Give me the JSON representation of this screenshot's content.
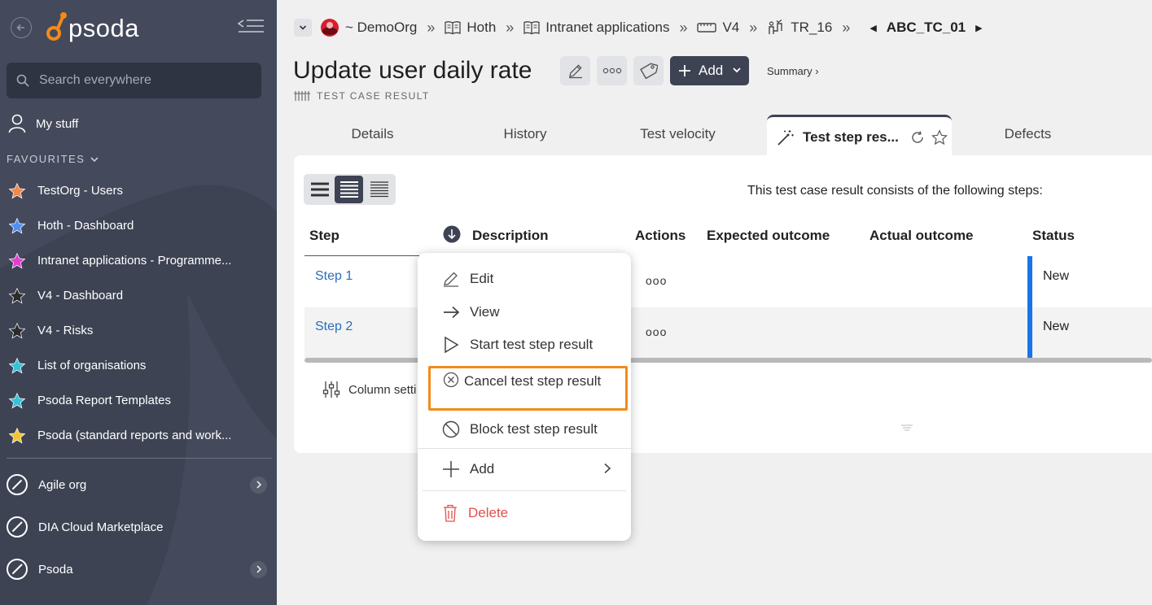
{
  "sidebar": {
    "logo_text": "psoda",
    "search_placeholder": "Search everywhere",
    "my_stuff": "My stuff",
    "favourites_label": "FAVOURITES",
    "favourites": [
      {
        "label": "TestOrg - Users",
        "color": "#f2894a"
      },
      {
        "label": "Hoth - Dashboard",
        "color": "#4f8ff0"
      },
      {
        "label": "Intranet applications - Programme...",
        "color": "#e03fd0"
      },
      {
        "label": "V4 - Dashboard",
        "color": "#2b2b2b"
      },
      {
        "label": "V4 - Risks",
        "color": "#2b2b2b"
      },
      {
        "label": "List of organisations",
        "color": "#3ac1d9"
      },
      {
        "label": "Psoda Report Templates",
        "color": "#3ac1d9"
      },
      {
        "label": "Psoda (standard reports and work...",
        "color": "#f2c530"
      }
    ],
    "organisations": [
      {
        "label": "Agile org",
        "has_children": true
      },
      {
        "label": "DIA Cloud Marketplace",
        "has_children": false
      },
      {
        "label": "Psoda",
        "has_children": true
      }
    ]
  },
  "breadcrumb": {
    "items": [
      "~ DemoOrg",
      "Hoth",
      "Intranet applications",
      "V4",
      "TR_16"
    ],
    "current": "ABC_TC_01",
    "separator": "»"
  },
  "header": {
    "title": "Update user daily rate",
    "add_label": "Add",
    "summary_link": "Summary ›",
    "subtitle": "TEST CASE RESULT"
  },
  "tabs": {
    "details": "Details",
    "history": "History",
    "velocity": "Test velocity",
    "active": "Test step res...",
    "defects": "Defects"
  },
  "content": {
    "intro": "This test case result consists of the following steps:",
    "column_settings": "Column setti",
    "columns": [
      "Step",
      "Description",
      "Actions",
      "Expected outcome",
      "Actual outcome",
      "Status"
    ],
    "rows": [
      {
        "step": "Step 1",
        "actions": "ooo",
        "status": "New"
      },
      {
        "step": "Step 2",
        "actions": "ooo",
        "status": "New"
      }
    ]
  },
  "context_menu": {
    "edit": "Edit",
    "view": "View",
    "start": "Start test step result",
    "cancel": "Cancel test step result",
    "block": "Block test step result",
    "add": "Add",
    "delete": "Delete"
  },
  "colors": {
    "sidebar_bg": "#3d4353",
    "accent_blue": "#1a73e8",
    "link_blue": "#2a6ebb",
    "highlight_orange": "#f28b1a",
    "delete_red": "#e0504e"
  }
}
